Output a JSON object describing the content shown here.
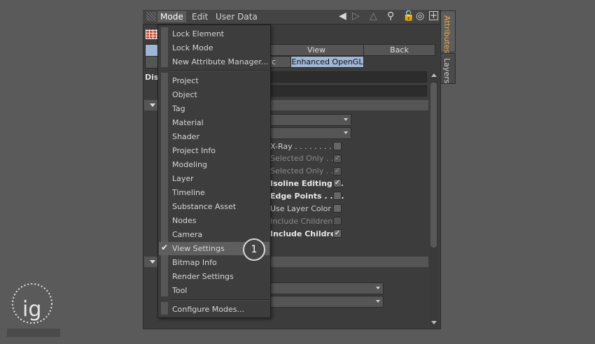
{
  "menubar": {
    "items": [
      "Mode",
      "Edit",
      "User Data"
    ]
  },
  "toolbar_icons": [
    "arrow-left-icon",
    "arrow-up-icon",
    "search-icon",
    "lock-icon",
    "target-icon",
    "new-panel-icon"
  ],
  "side_tabs": [
    "Attributes",
    "Layers"
  ],
  "header_tabs": {
    "view": "View",
    "back": "Back",
    "partial": "ic",
    "renderer": "Enhanced OpenGL"
  },
  "display_label": "Dis",
  "options": [
    {
      "label": "X-Ray . . . . . . . . .",
      "state": "dim-normal",
      "checked": false
    },
    {
      "label": "Selected Only . .",
      "state": "dim",
      "checked": true
    },
    {
      "label": "Selected Only . .",
      "state": "dim",
      "checked": true
    },
    {
      "label": "Isoline Editing . .",
      "state": "bold",
      "checked": true
    },
    {
      "label": "Edge Points . . . .",
      "state": "bold",
      "checked": false
    },
    {
      "label": "Use Layer Color",
      "state": "normal",
      "checked": false
    },
    {
      "label": "Include Children",
      "state": "dim",
      "checked": false
    },
    {
      "label": "Include Children",
      "state": "bold",
      "checked": true
    }
  ],
  "menu": {
    "group1": [
      "Lock Element",
      "Lock Mode",
      "New Attribute Manager..."
    ],
    "group2": [
      "Project",
      "Object",
      "Tag",
      "Material",
      "Shader",
      "Project Info",
      "Modeling",
      "Layer",
      "Timeline",
      "Substance Asset",
      "Nodes",
      "Camera",
      "View Settings",
      "Bitmap Info",
      "Render Settings",
      "Tool"
    ],
    "group3": [
      "Configure Modes..."
    ],
    "checked_item": "View Settings"
  },
  "callout": "1",
  "colors": {
    "highlight": "#9fb6d6",
    "active_tab_text": "#e8a94c"
  }
}
